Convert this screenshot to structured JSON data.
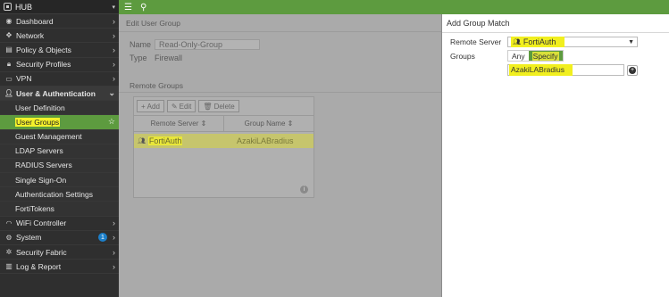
{
  "header": {
    "device": "HUB"
  },
  "sidebar": {
    "items": [
      {
        "label": "Dashboard",
        "icon": "dashboard-icon"
      },
      {
        "label": "Network",
        "icon": "network-icon"
      },
      {
        "label": "Policy & Objects",
        "icon": "policy-icon"
      },
      {
        "label": "Security Profiles",
        "icon": "lock-icon"
      },
      {
        "label": "VPN",
        "icon": "vpn-icon"
      },
      {
        "label": "User & Authentication",
        "icon": "user-icon"
      }
    ],
    "sub_items": [
      "User Definition",
      "User Groups",
      "Guest Management",
      "LDAP Servers",
      "RADIUS Servers",
      "Single Sign-On",
      "Authentication Settings",
      "FortiTokens"
    ],
    "items_after": [
      {
        "label": "WiFi Controller",
        "icon": "wifi-icon"
      },
      {
        "label": "System",
        "icon": "gear-icon",
        "badge": "1"
      },
      {
        "label": "Security Fabric",
        "icon": "fabric-icon"
      },
      {
        "label": "Log & Report",
        "icon": "chart-icon"
      }
    ]
  },
  "main": {
    "title": "Edit User Group",
    "name_label": "Name",
    "name_value": "Read-Only-Group",
    "type_label": "Type",
    "type_value": "Firewall",
    "remote_groups_title": "Remote Groups",
    "toolbar": {
      "add": "Add",
      "edit": "Edit",
      "delete": "Delete"
    },
    "columns": [
      "Remote Server",
      "Group Name"
    ],
    "rows": [
      {
        "server": "FortiAuth",
        "group": "AzakiLABradius"
      }
    ]
  },
  "panel": {
    "title": "Add Group Match",
    "remote_server_label": "Remote Server",
    "remote_server_value": "FortiAuth",
    "groups_label": "Groups",
    "toggle_any": "Any",
    "toggle_specify": "Specify",
    "group_value": "AzakiLABradius"
  },
  "colors": {
    "accent": "#5d9b3f",
    "highlight": "#f1ef1f",
    "sidebar_bg": "#2f2f2f"
  }
}
